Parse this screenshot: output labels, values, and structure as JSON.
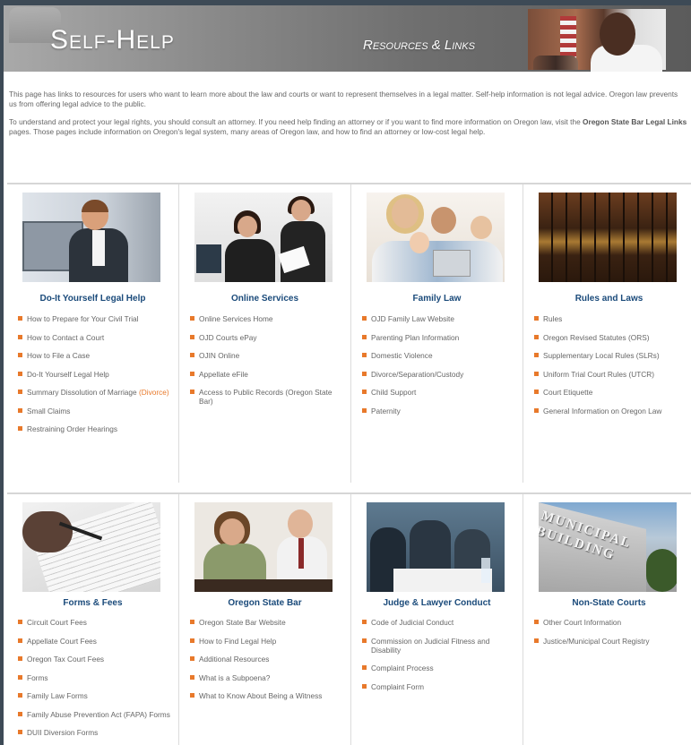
{
  "banner": {
    "title": "Self-Help",
    "subtitle": "Resources & Links"
  },
  "intro": {
    "p1": "This page has links to resources for users who want to learn more about the law and courts or want to represent themselves in a legal matter. Self-help information is not legal advice. Oregon law prevents us from offering legal advice to the public.",
    "p2_before": "To understand and protect your legal rights, you should consult an attorney. If you need help finding an attorney or if you want to find more information on Oregon law, visit the ",
    "p2_link": "Oregon State Bar Legal Links",
    "p2_after": " pages. Those pages include information on Oregon's legal system, many areas of Oregon law, and how to find an attorney or low-cost legal help."
  },
  "sections_top": [
    {
      "title": "Do-It Yourself Legal Help",
      "items": [
        "How to Prepare for Your Civil Trial",
        "How to Contact a Court",
        "How to File a Case",
        "Do-It Yourself Legal Help",
        "Small Claims",
        "Restraining Order Hearings"
      ],
      "special": {
        "text": "Summary Dissolution of Marriage",
        "accent": "(Divorce)"
      }
    },
    {
      "title": "Online Services",
      "items": [
        "Online Services Home",
        "OJD Courts ePay",
        "OJIN Online",
        "Appellate eFile",
        "Access to Public Records (Oregon State Bar)"
      ]
    },
    {
      "title": "Family Law",
      "items": [
        "OJD Family Law Website",
        "Parenting Plan Information",
        "Domestic Violence",
        "Divorce/Separation/Custody",
        "Child Support",
        "Paternity"
      ]
    },
    {
      "title": "Rules and Laws",
      "items": [
        "Rules",
        "Oregon Revised Statutes (ORS)",
        "Supplementary Local Rules (SLRs)",
        "Uniform Trial Court Rules (UTCR)",
        "Court Etiquette",
        "General Information on Oregon Law"
      ]
    }
  ],
  "sections_bottom": [
    {
      "title": "Forms & Fees",
      "items": [
        "Circuit Court Fees",
        "Appellate Court Fees",
        "Oregon Tax Court Fees",
        "Forms",
        "Family Law Forms",
        "Family Abuse Prevention Act (FAPA) Forms",
        "DUII Diversion Forms"
      ]
    },
    {
      "title": "Oregon State Bar",
      "items": [
        "Oregon State Bar Website",
        "How to Find Legal Help",
        "Additional Resources",
        "What is a Subpoena?",
        "What to Know About Being a Witness"
      ]
    },
    {
      "title": "Judge & Lawyer Conduct",
      "items": [
        "Code of Judicial Conduct",
        "Commission on Judicial Fitness and Disability",
        "Complaint Process",
        "Complaint Form"
      ]
    },
    {
      "title": "Non-State Courts",
      "items": [
        "Other Court Information",
        "Justice/Municipal Court Registry"
      ]
    }
  ],
  "images": {
    "muni_text": "MUNICIPAL BUILDING"
  },
  "colors": {
    "accent": "#e8792b",
    "heading": "#1a4a7a",
    "body_text": "#666666"
  }
}
